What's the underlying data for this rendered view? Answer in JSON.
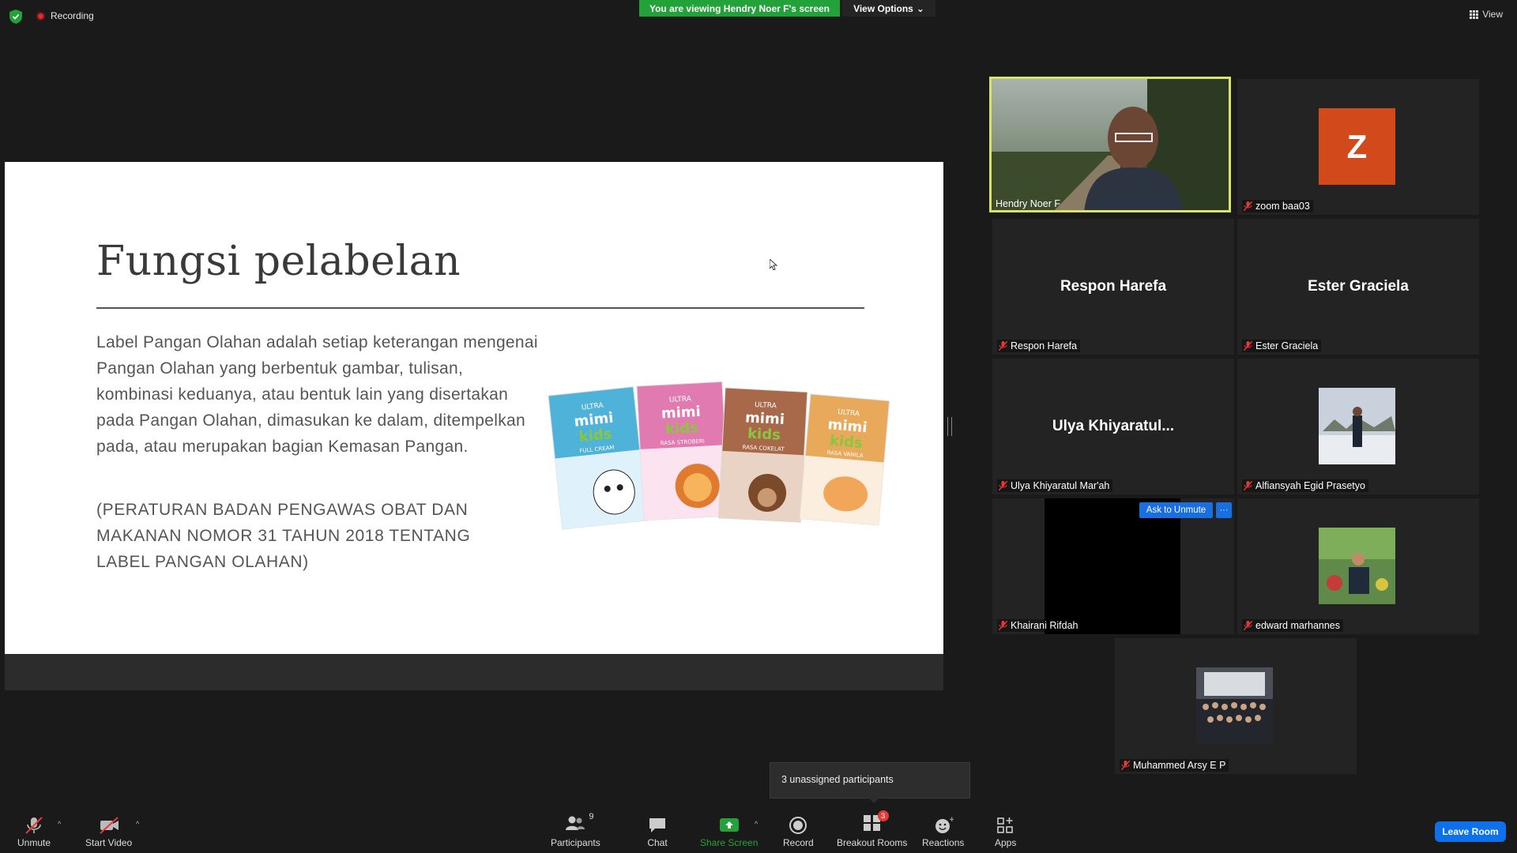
{
  "top": {
    "recording_label": "Recording",
    "viewing_banner": "You are viewing Hendry Noer F's screen",
    "view_options": "View Options",
    "view_label": "View"
  },
  "slide": {
    "title": "Fungsi pelabelan",
    "body": "Label Pangan Olahan adalah setiap keterangan mengenai Pangan Olahan yang berbentuk gambar, tulisan, kombinasi keduanya, atau bentuk lain yang disertakan pada Pangan Olahan, dimasukan ke dalam, ditempelkan pada, atau merupakan bagian Kemasan Pangan.",
    "reference": "(PERATURAN BADAN PENGAWAS OBAT DAN MAKANAN NOMOR 31 TAHUN 2018 TENTANG LABEL PANGAN OLAHAN)",
    "products": [
      {
        "brand": "ULTRA",
        "name": "mimi",
        "sub": "kids",
        "variant": "FULL CREAM",
        "color": "#4fb3d9"
      },
      {
        "brand": "ULTRA",
        "name": "mimi",
        "sub": "kids",
        "variant": "RASA STROBERI",
        "color": "#e07ab0"
      },
      {
        "brand": "ULTRA",
        "name": "mimi",
        "sub": "kids",
        "variant": "RASA COKELAT",
        "color": "#a8684a"
      },
      {
        "brand": "ULTRA",
        "name": "mimi",
        "sub": "kids",
        "variant": "RASA VANILA",
        "color": "#e8a95a"
      }
    ]
  },
  "participants": [
    {
      "name": "Hendry Noer F",
      "display": "",
      "type": "video"
    },
    {
      "name": "zoom baa03",
      "display": "Z",
      "type": "avatar"
    },
    {
      "name": "Respon Harefa",
      "display": "Respon Harefa",
      "type": "name"
    },
    {
      "name": "Ester Graciela",
      "display": "Ester Graciela",
      "type": "name"
    },
    {
      "name": "Ulya Khiyaratul Mar'ah",
      "display": "Ulya  Khiyaratul...",
      "type": "name"
    },
    {
      "name": "Alfiansyah Egid Prasetyo",
      "display": "",
      "type": "photo"
    },
    {
      "name": "Khairani Rifdah",
      "display": "",
      "type": "black"
    },
    {
      "name": "edward marhannes",
      "display": "",
      "type": "photo"
    },
    {
      "name": "Muhammed Arsy E P",
      "display": "",
      "type": "photo"
    }
  ],
  "hover": {
    "ask_to_unmute": "Ask to Unmute",
    "more": "···"
  },
  "tooltip": "3 unassigned participants",
  "toolbar": {
    "unmute": "Unmute",
    "start_video": "Start Video",
    "participants": "Participants",
    "participants_count": "9",
    "chat": "Chat",
    "share_screen": "Share Screen",
    "record": "Record",
    "breakout_rooms": "Breakout Rooms",
    "breakout_badge": "3",
    "reactions": "Reactions",
    "apps": "Apps",
    "leave_room": "Leave Room",
    "caret": "^"
  },
  "colors": {
    "share_green": "#23a23a",
    "active_speaker": "#d9e36a",
    "leave_blue": "#0e71eb",
    "z_avatar": "#d24a1c"
  }
}
